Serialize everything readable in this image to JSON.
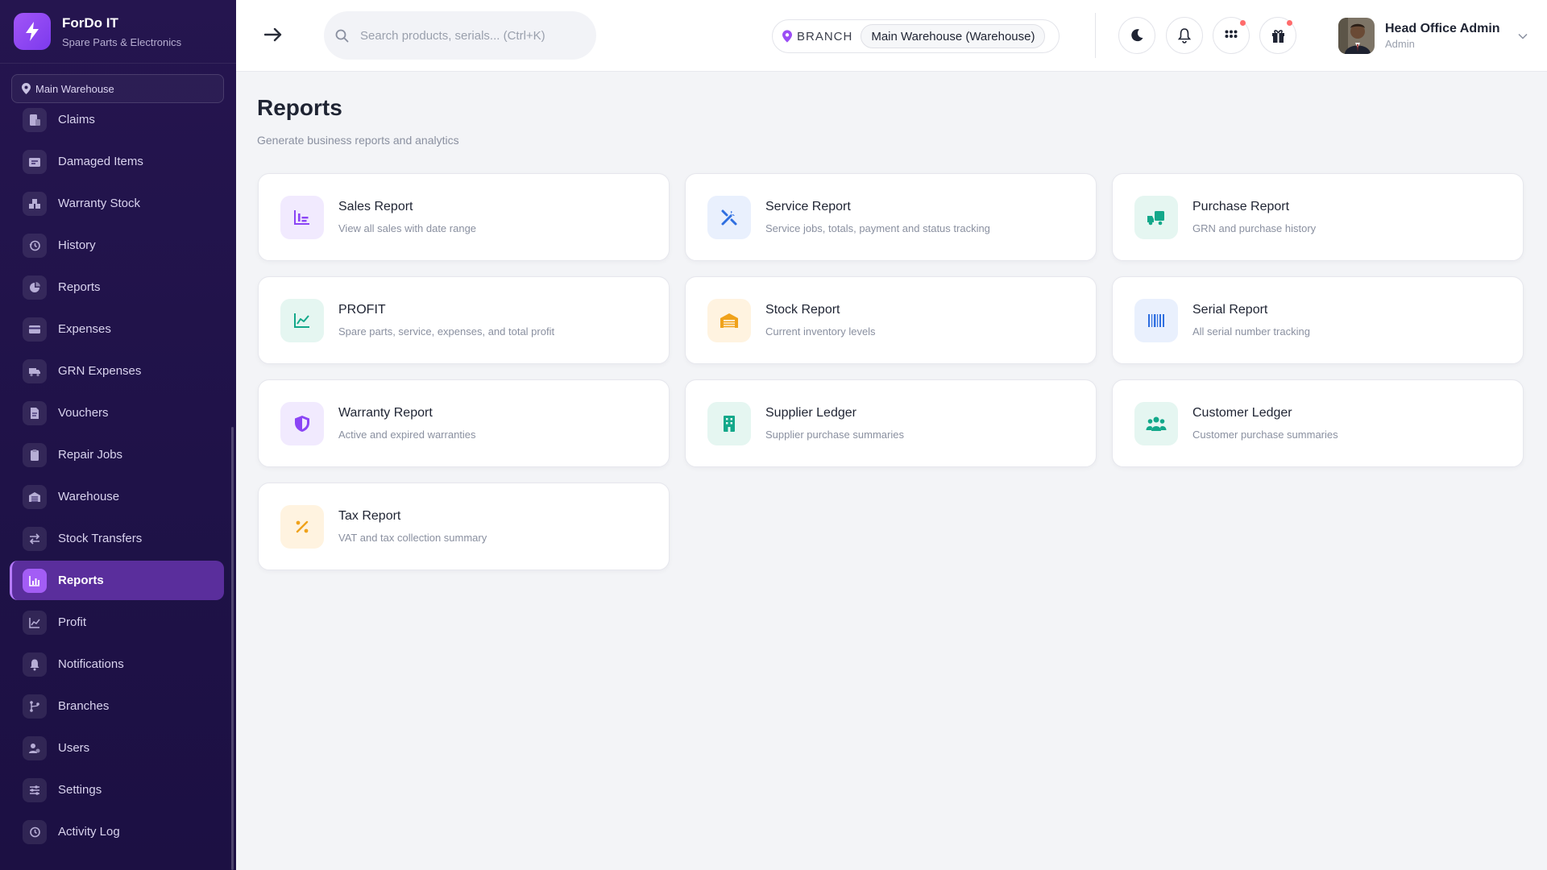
{
  "brand": {
    "name": "ForDo IT",
    "subtitle": "Spare Parts & Electronics",
    "accent": "#8b45f5"
  },
  "sidebar": {
    "branch": "Main Warehouse",
    "items": [
      {
        "label": "Claims",
        "icon": "claims-icon"
      },
      {
        "label": "Damaged Items",
        "icon": "damaged-items-icon"
      },
      {
        "label": "Warranty Stock",
        "icon": "warranty-stock-icon"
      },
      {
        "label": "History",
        "icon": "history-icon"
      },
      {
        "label": "Reports",
        "icon": "pie-chart-icon"
      },
      {
        "label": "Expenses",
        "icon": "wallet-icon"
      },
      {
        "label": "GRN Expenses",
        "icon": "truck-icon"
      },
      {
        "label": "Vouchers",
        "icon": "voucher-icon"
      },
      {
        "label": "Repair Jobs",
        "icon": "clipboard-icon"
      },
      {
        "label": "Warehouse",
        "icon": "warehouse-icon"
      },
      {
        "label": "Stock Transfers",
        "icon": "transfer-icon"
      },
      {
        "label": "Reports",
        "icon": "bar-chart-icon",
        "active": true
      },
      {
        "label": "Profit",
        "icon": "line-chart-icon"
      },
      {
        "label": "Notifications",
        "icon": "bell-icon"
      },
      {
        "label": "Branches",
        "icon": "branch-icon"
      },
      {
        "label": "Users",
        "icon": "users-icon"
      },
      {
        "label": "Settings",
        "icon": "sliders-icon"
      },
      {
        "label": "Activity Log",
        "icon": "activity-log-icon"
      }
    ]
  },
  "header": {
    "search_placeholder": "Search products, serials... (Ctrl+K)",
    "branch_label": "BRANCH",
    "branch_value": "Main Warehouse (Warehouse)",
    "user_name": "Head Office Admin",
    "user_role": "Admin"
  },
  "main": {
    "title": "Reports",
    "subtitle": "Generate business reports and analytics",
    "cards": [
      {
        "title": "Sales Report",
        "desc": "View all sales with date range",
        "icon": "sales-chart-icon",
        "color": "#8b45f5",
        "bg": "#f1eafe"
      },
      {
        "title": "Service Report",
        "desc": "Service jobs, totals, payment and status tracking",
        "icon": "tools-icon",
        "color": "#2f6fe0",
        "bg": "#e9f0fd"
      },
      {
        "title": "Purchase Report",
        "desc": "GRN and purchase history",
        "icon": "truck-icon",
        "color": "#13a88a",
        "bg": "#e5f6f1"
      },
      {
        "title": "PROFIT",
        "desc": "Spare parts, service, expenses, and total profit",
        "icon": "line-chart-icon",
        "color": "#13a88a",
        "bg": "#e5f6f1"
      },
      {
        "title": "Stock Report",
        "desc": "Current inventory levels",
        "icon": "warehouse-icon",
        "color": "#f0a21b",
        "bg": "#fff3e0"
      },
      {
        "title": "Serial Report",
        "desc": "All serial number tracking",
        "icon": "barcode-icon",
        "color": "#2f6fe0",
        "bg": "#e9f0fd"
      },
      {
        "title": "Warranty Report",
        "desc": "Active and expired warranties",
        "icon": "shield-icon",
        "color": "#8b45f5",
        "bg": "#f1eafe"
      },
      {
        "title": "Supplier Ledger",
        "desc": "Supplier purchase summaries",
        "icon": "building-icon",
        "color": "#13a88a",
        "bg": "#e5f6f1"
      },
      {
        "title": "Customer Ledger",
        "desc": "Customer purchase summaries",
        "icon": "users-icon",
        "color": "#13a88a",
        "bg": "#e5f6f1"
      },
      {
        "title": "Tax Report",
        "desc": "VAT and tax collection summary",
        "icon": "percent-icon",
        "color": "#f0a21b",
        "bg": "#fff3e0"
      }
    ]
  }
}
